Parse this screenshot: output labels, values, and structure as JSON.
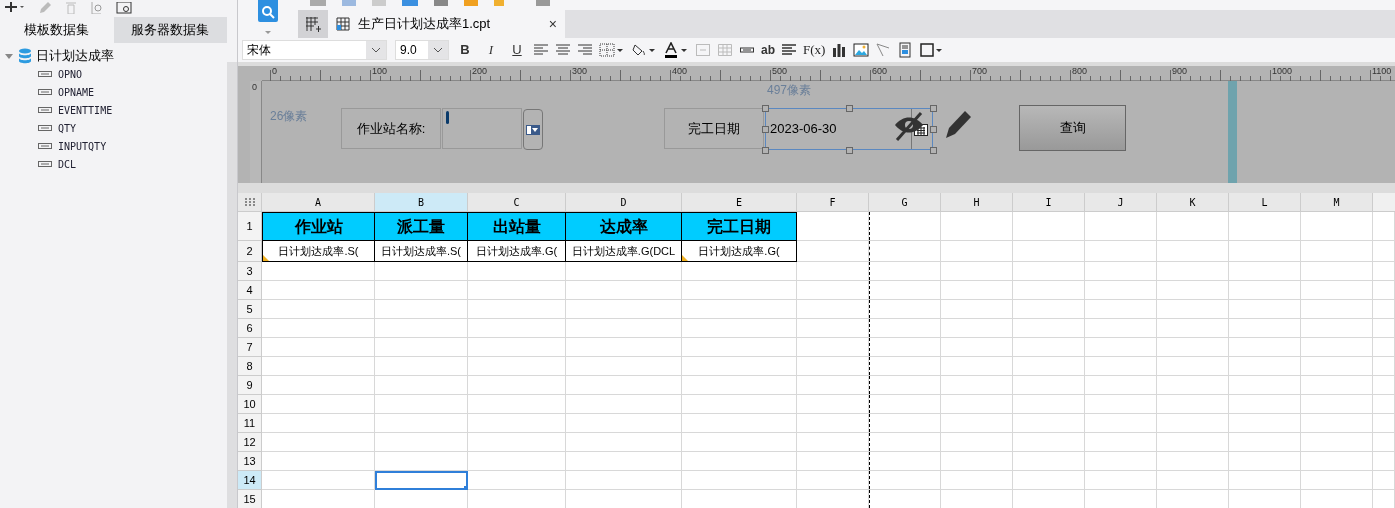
{
  "dataset_tabs": [
    {
      "label": "模板数据集",
      "selected": true
    },
    {
      "label": "服务器数据集",
      "selected": false
    }
  ],
  "dataset_tree": {
    "label": "日计划达成率",
    "expanded": true,
    "children": [
      {
        "label": "OPNO"
      },
      {
        "label": "OPNAME"
      },
      {
        "label": "EVENTTIME"
      },
      {
        "label": "QTY"
      },
      {
        "label": "INPUTQTY"
      },
      {
        "label": "DCL"
      }
    ]
  },
  "file_tab": {
    "title": "生产日计划达成率1.cpt",
    "close": "×"
  },
  "format_toolbar": {
    "font": "宋体",
    "size": "9.0",
    "style_buttons": [
      "B",
      "I",
      "U"
    ],
    "text_tools": [
      "ab",
      "F(x)"
    ]
  },
  "parameter_panel": {
    "ruler_labels": [
      "0",
      "100",
      "200",
      "300",
      "400",
      "500",
      "600",
      "700",
      "800",
      "900",
      "1000",
      "1100"
    ],
    "vertical_ruler_label": "0",
    "height_note": "26像素",
    "width_note": "497像素",
    "widgets": [
      {
        "kind": "label",
        "text": "作业站名称:"
      },
      {
        "kind": "combo"
      },
      {
        "kind": "label",
        "text": "完工日期"
      },
      {
        "kind": "date",
        "value": "2023-06-30",
        "selected": true
      },
      {
        "kind": "button",
        "text": "查询"
      }
    ]
  },
  "sheet": {
    "columns": [
      {
        "label": "A",
        "selected": false
      },
      {
        "label": "B",
        "selected": true
      },
      {
        "label": "C",
        "selected": false
      },
      {
        "label": "D",
        "selected": false
      },
      {
        "label": "E",
        "selected": false
      },
      {
        "label": "F",
        "selected": false
      },
      {
        "label": "G",
        "selected": false
      },
      {
        "label": "H",
        "selected": false
      },
      {
        "label": "I",
        "selected": false
      },
      {
        "label": "J",
        "selected": false
      },
      {
        "label": "K",
        "selected": false
      },
      {
        "label": "L",
        "selected": false
      },
      {
        "label": "M",
        "selected": false
      }
    ],
    "rows": [
      {
        "label": "1",
        "selected": false,
        "kind": "header",
        "cells": [
          {
            "text": "作业站"
          },
          {
            "text": "派工量"
          },
          {
            "text": "出站量"
          },
          {
            "text": "达成率"
          },
          {
            "text": "完工日期"
          }
        ]
      },
      {
        "label": "2",
        "selected": false,
        "kind": "formula",
        "cells": [
          {
            "text": "日计划达成率.S(",
            "flagged": true
          },
          {
            "text": "日计划达成率.S(",
            "flagged": false
          },
          {
            "text": "日计划达成率.G(",
            "flagged": false
          },
          {
            "text": "日计划达成率.G(DCL",
            "flagged": false
          },
          {
            "text": "日计划达成率.G(",
            "flagged": true
          }
        ]
      },
      {
        "label": "3",
        "selected": false
      },
      {
        "label": "4",
        "selected": false
      },
      {
        "label": "5",
        "selected": false
      },
      {
        "label": "6",
        "selected": false
      },
      {
        "label": "7",
        "selected": false
      },
      {
        "label": "8",
        "selected": false
      },
      {
        "label": "9",
        "selected": false
      },
      {
        "label": "10",
        "selected": false
      },
      {
        "label": "11",
        "selected": false
      },
      {
        "label": "12",
        "selected": false
      },
      {
        "label": "13",
        "selected": false
      },
      {
        "label": "14",
        "selected": true
      },
      {
        "label": "15",
        "selected": false
      }
    ]
  }
}
